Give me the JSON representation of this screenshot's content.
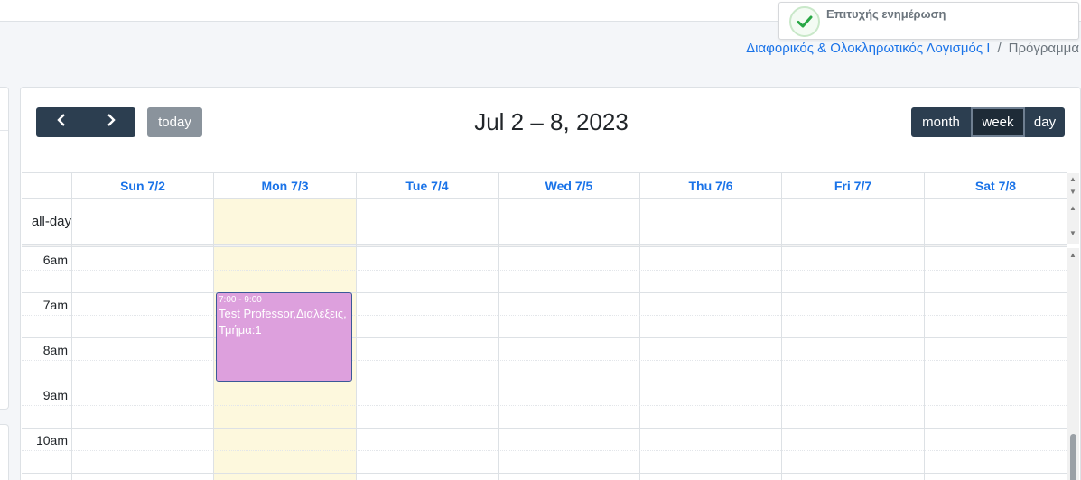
{
  "notification": {
    "message": "Επιτυχής ενημέρωση",
    "icon": "check-icon",
    "color": "#28a745"
  },
  "breadcrumb": {
    "course": "Διαφορικός & Ολοκληρωτικός Λογισμός Ι",
    "current": "Πρόγραμμα"
  },
  "toolbar": {
    "prev_icon": "chevron-left-icon",
    "next_icon": "chevron-right-icon",
    "today_label": "today",
    "title": "Jul 2 – 8, 2023",
    "views": {
      "month": "month",
      "week": "week",
      "day": "day"
    },
    "active_view": "week"
  },
  "calendar": {
    "days": [
      "Sun 7/2",
      "Mon 7/3",
      "Tue 7/4",
      "Wed 7/5",
      "Thu 7/6",
      "Fri 7/7",
      "Sat 7/8"
    ],
    "today_index": 1,
    "allday_label": "all-day",
    "times": [
      "6am",
      "7am",
      "8am",
      "9am",
      "10am"
    ],
    "events": [
      {
        "day": "Mon 7/3",
        "time": "7:00 - 9:00",
        "title": "Test Professor,Διαλέξεις, Τμήμα:1",
        "color": "#dda0dd"
      }
    ]
  },
  "colors": {
    "accent": "#1a73e8",
    "button": "#2c3e50",
    "today_bg": "#fdf8dd"
  }
}
